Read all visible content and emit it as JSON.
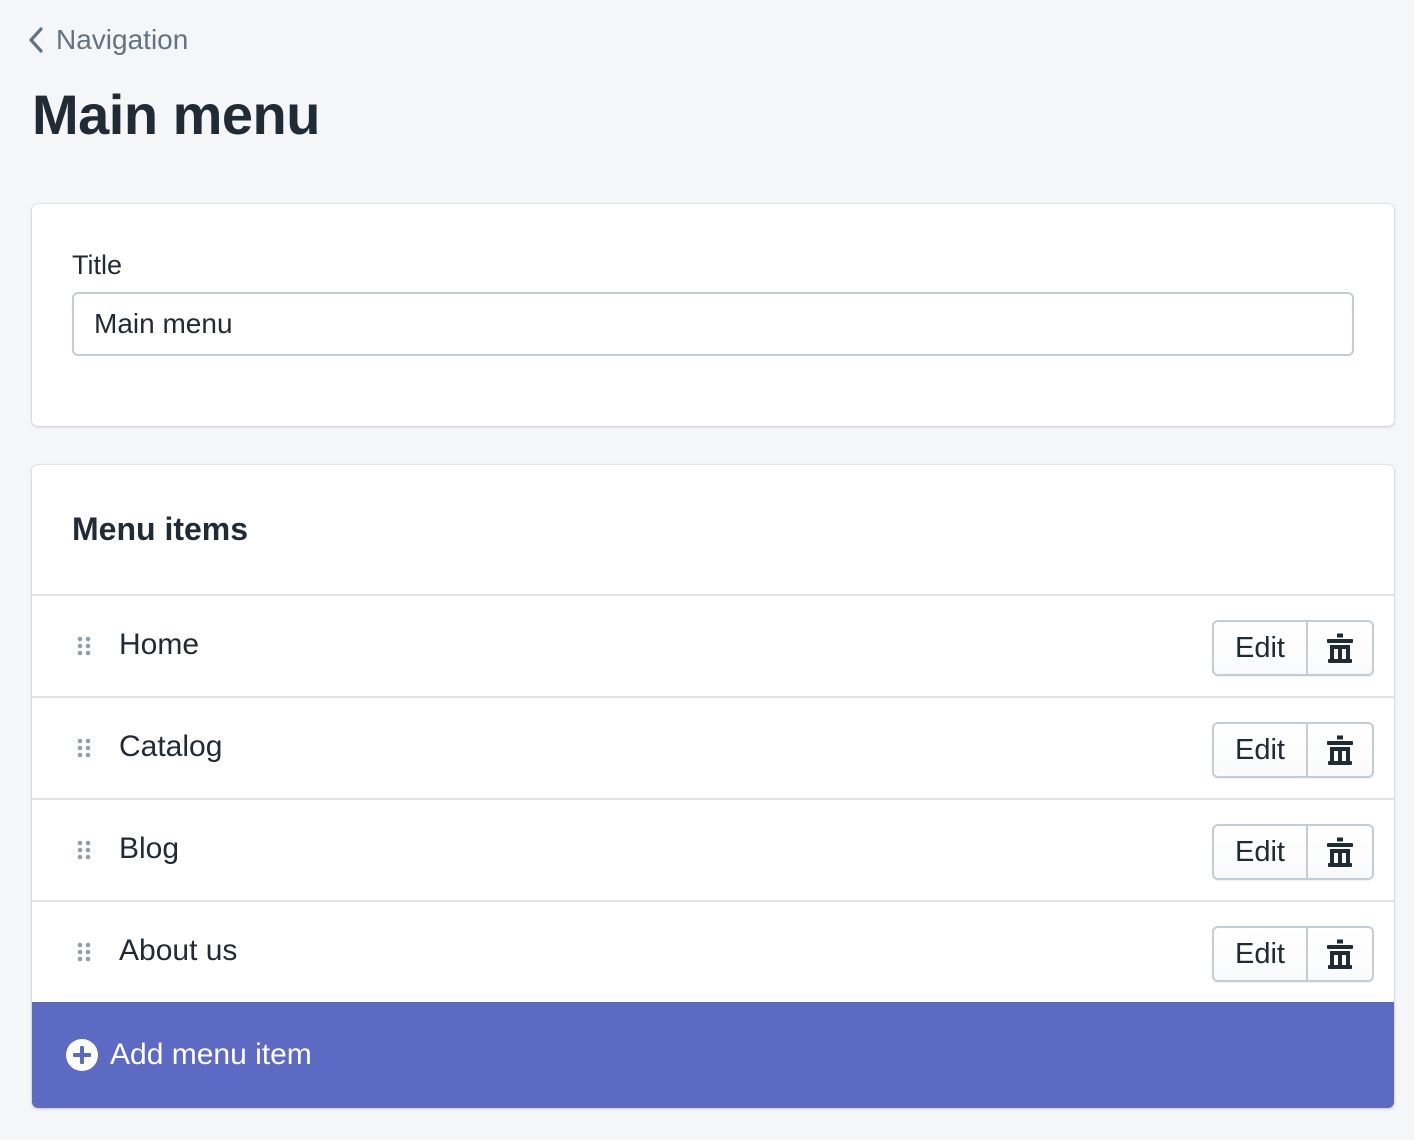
{
  "breadcrumb": {
    "label": "Navigation"
  },
  "page": {
    "title": "Main menu"
  },
  "title_card": {
    "label": "Title",
    "input_value": "Main menu"
  },
  "menu_card": {
    "heading": "Menu items",
    "items": [
      {
        "label": "Home",
        "edit_label": "Edit"
      },
      {
        "label": "Catalog",
        "edit_label": "Edit"
      },
      {
        "label": "Blog",
        "edit_label": "Edit"
      },
      {
        "label": "About us",
        "edit_label": "Edit"
      }
    ],
    "add_label": "Add menu item"
  },
  "icons": {
    "back": "chevron-left-icon",
    "drag": "drag-handle-icon",
    "delete": "trash-icon",
    "add": "plus-circle-icon"
  },
  "colors": {
    "background": "#f4f6f8",
    "accent": "#5c6ac4",
    "text": "#212b36",
    "subdued": "#637381"
  }
}
